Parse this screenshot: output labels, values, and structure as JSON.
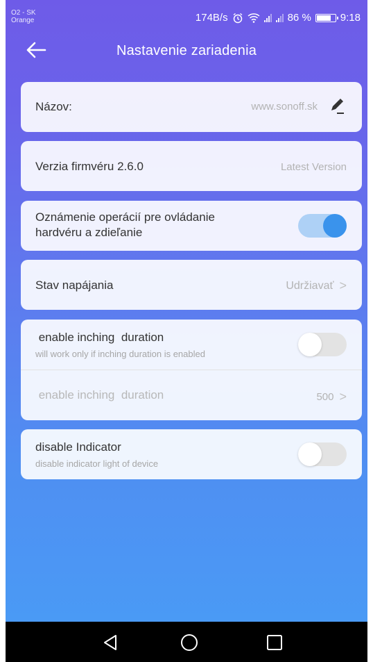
{
  "status_bar": {
    "carrier_line1": "O2 - SK",
    "carrier_line2": "Orange",
    "speed": "174B/s",
    "battery_percent": "86 %",
    "time": "9:18"
  },
  "header": {
    "title": "Nastavenie zariadenia"
  },
  "name_card": {
    "label": "Názov:",
    "value": "www.sonoff.sk"
  },
  "firmware_card": {
    "label": "Verzia firmvéru 2.6.0",
    "value": "Latest Version"
  },
  "notify_card": {
    "label_line1": "Oznámenie operácií pre ovládanie",
    "label_line2": "hardvéru a zdieľanie",
    "enabled": true
  },
  "power_card": {
    "label": "Stav napájania",
    "value": "Udržiavať"
  },
  "inching_card": {
    "toggle_label": " enable inching  duration",
    "toggle_sub": "will work only if inching duration is enabled",
    "toggle_enabled": false,
    "duration_label": " enable inching  duration",
    "duration_value": "500"
  },
  "indicator_card": {
    "label": "disable Indicator",
    "sub": "disable indicator light of device",
    "enabled": false
  },
  "nav_bar": {
    "back": "back-triangle",
    "home": "home-circle",
    "recents": "recents-square"
  }
}
